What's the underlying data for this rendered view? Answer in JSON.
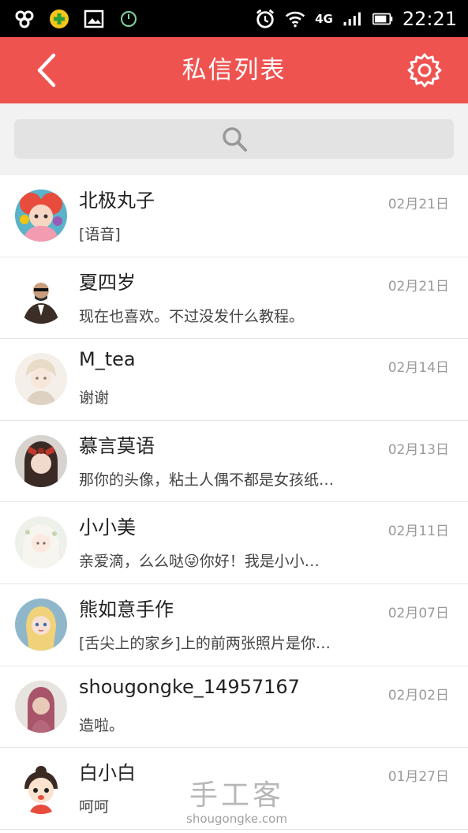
{
  "status_bar": {
    "network": "4G",
    "time": "22:21"
  },
  "header": {
    "title": "私信列表"
  },
  "search": {
    "placeholder": ""
  },
  "conversations": [
    {
      "name": "北极丸子",
      "message": "[语音]",
      "date": "02月21日"
    },
    {
      "name": "夏四岁",
      "message": "现在也喜欢。不过没发什么教程。",
      "date": "02月21日"
    },
    {
      "name": "M_tea",
      "message": "谢谢",
      "date": "02月14日"
    },
    {
      "name": "慕言莫语",
      "message": "那你的头像，粘土人偶不都是女孩纸…",
      "date": "02月13日"
    },
    {
      "name": "小小美",
      "message": "亲爱滴，么么哒😜你好！我是小小…",
      "date": "02月11日"
    },
    {
      "name": "熊如意手作",
      "message": "[舌尖上的家乡]上的前两张照片是你…",
      "date": "02月07日"
    },
    {
      "name": "shougongke_14957167",
      "message": "造啦。",
      "date": "02月02日"
    },
    {
      "name": "白小白",
      "message": "呵呵",
      "date": "01月27日"
    }
  ],
  "watermark": {
    "brand": "手工客",
    "domain": "shougongke.com"
  },
  "colors": {
    "header": "#ef5350",
    "status_bar": "#000000",
    "search_bg": "#e3e3e3"
  }
}
